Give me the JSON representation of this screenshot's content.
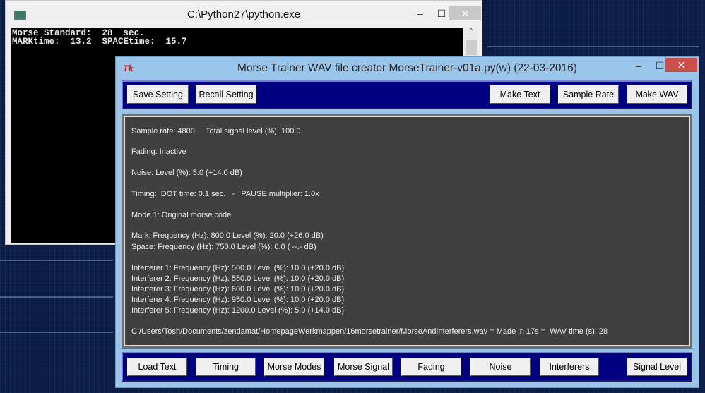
{
  "console": {
    "title": "C:\\Python27\\python.exe",
    "lines": [
      "Morse Standard:  28  sec.",
      "MARKtime:  13.2  SPACEtime:  15.7"
    ]
  },
  "main": {
    "title": "Morse Trainer WAV file creator MorseTrainer-v01a.py(w) (22-03-2016)",
    "app_icon": "Tk",
    "top_buttons": [
      "Save Setting",
      "Recall Setting",
      "Make Text",
      "Sample Rate",
      "Make WAV"
    ],
    "bottom_buttons": [
      "Load Text",
      "Timing",
      "Morse Modes",
      "Morse Signal",
      "Fading",
      "Noise",
      "Interferers",
      "Signal Level"
    ],
    "text_lines": [
      "Sample rate: 4800     Total signal level (%): 100.0",
      "Fading: Inactive",
      "Noise: Level (%): 5.0 (+14.0 dB)",
      "Timing:  DOT time: 0.1 sec.   -   PAUSE multiplier: 1.0x",
      "Mode 1: Original morse code",
      "Mark: Frequency (Hz): 800.0 Level (%): 20.0 (+26.0 dB)",
      "Space: Frequency (Hz): 750.0 Level (%): 0.0 ( --.- dB)",
      "Interferer 1: Frequency (Hz): 500.0 Level (%): 10.0 (+20.0 dB)",
      "Interferer 2: Frequency (Hz): 550.0 Level (%): 10.0 (+20.0 dB)",
      "Interferer 3: Frequency (Hz): 600.0 Level (%): 10.0 (+20.0 dB)",
      "Interferer 4: Frequency (Hz): 950.0 Level (%): 10.0 (+20.0 dB)",
      "Interferer 5: Frequency (Hz): 1200.0 Level (%): 5.0 (+14.0 dB)",
      "C:/Users/Tosh/Documents/zendamat/HomepageWerkmappen/16morsetrainer/MorseAndInterferers.wav = Made in 17s =  WAV time (s): 28"
    ]
  },
  "window_controls": {
    "minimize": "–",
    "maximize": "☐",
    "close": "✕"
  }
}
